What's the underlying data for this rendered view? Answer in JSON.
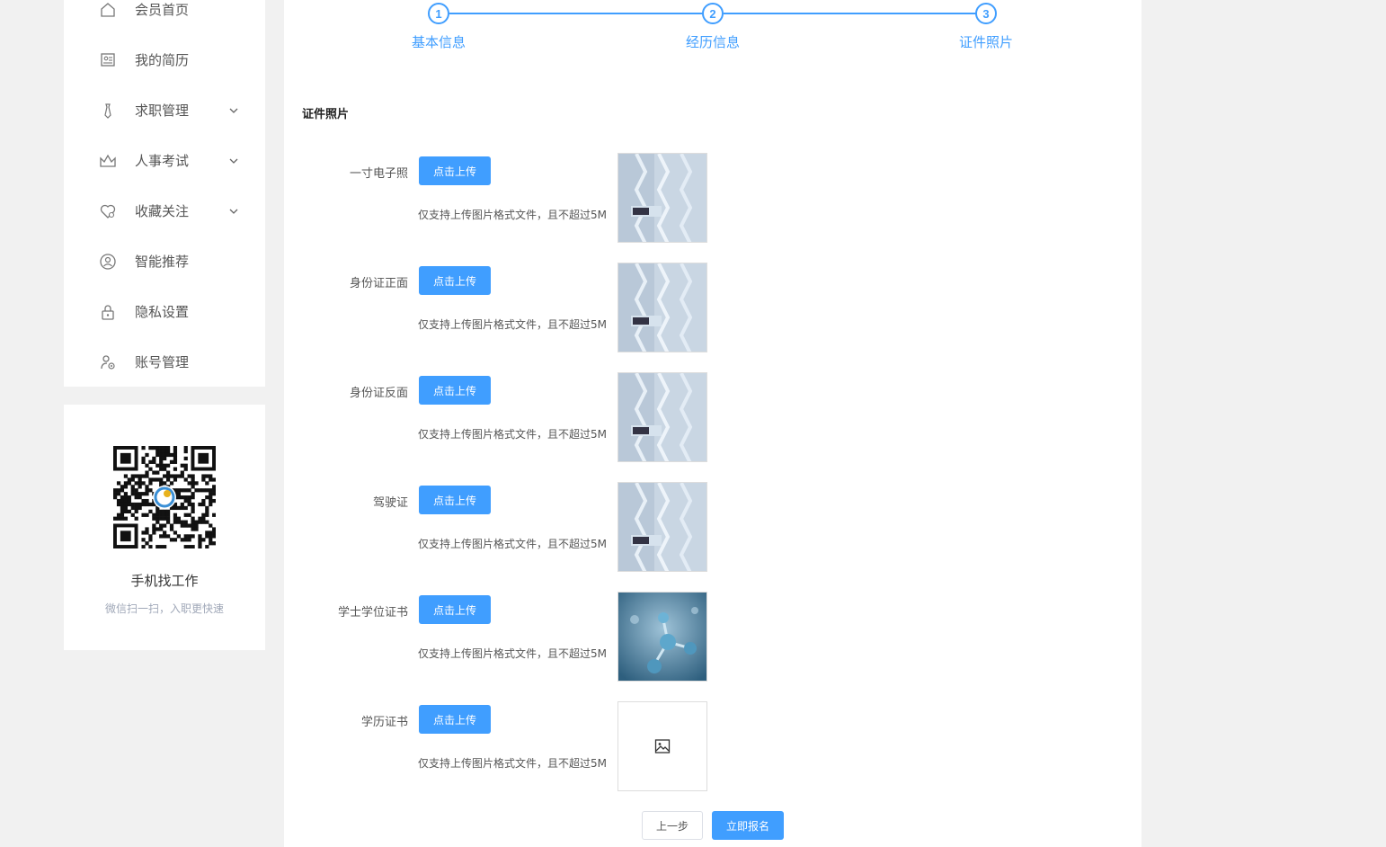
{
  "sidebar": {
    "items": [
      {
        "label": "会员首页",
        "icon": "home-icon"
      },
      {
        "label": "我的简历",
        "icon": "resume-icon"
      },
      {
        "label": "求职管理",
        "icon": "tie-icon",
        "expandable": true
      },
      {
        "label": "人事考试",
        "icon": "crown-icon",
        "expandable": true
      },
      {
        "label": "收藏关注",
        "icon": "heart-icon",
        "expandable": true
      },
      {
        "label": "智能推荐",
        "icon": "user-circle-icon"
      },
      {
        "label": "隐私设置",
        "icon": "lock-icon"
      },
      {
        "label": "账号管理",
        "icon": "user-gear-icon"
      }
    ]
  },
  "qr_card": {
    "title": "手机找工作",
    "subtitle": "微信扫一扫，入职更快速"
  },
  "steps": [
    {
      "number": "1",
      "label": "基本信息"
    },
    {
      "number": "2",
      "label": "经历信息"
    },
    {
      "number": "3",
      "label": "证件照片"
    }
  ],
  "section_title": "证件照片",
  "uploads": [
    {
      "label": "一寸电子照",
      "button": "点击上传",
      "hint": "仅支持上传图片格式文件，且不超过5M",
      "thumb": "lab-banner-image"
    },
    {
      "label": "身份证正面",
      "button": "点击上传",
      "hint": "仅支持上传图片格式文件，且不超过5M",
      "thumb": "lab-banner-image"
    },
    {
      "label": "身份证反面",
      "button": "点击上传",
      "hint": "仅支持上传图片格式文件，且不超过5M",
      "thumb": "lab-banner-image"
    },
    {
      "label": "驾驶证",
      "button": "点击上传",
      "hint": "仅支持上传图片格式文件，且不超过5M",
      "thumb": "lab-banner-image"
    },
    {
      "label": "学士学位证书",
      "button": "点击上传",
      "hint": "仅支持上传图片格式文件，且不超过5M",
      "thumb": "molecule-image"
    },
    {
      "label": "学历证书",
      "button": "点击上传",
      "hint": "仅支持上传图片格式文件，且不超过5M",
      "thumb": "image-placeholder-icon"
    }
  ],
  "actions": {
    "prev": "上一步",
    "submit": "立即报名"
  },
  "colors": {
    "primary": "#409eff",
    "background": "#f1f1f1"
  }
}
